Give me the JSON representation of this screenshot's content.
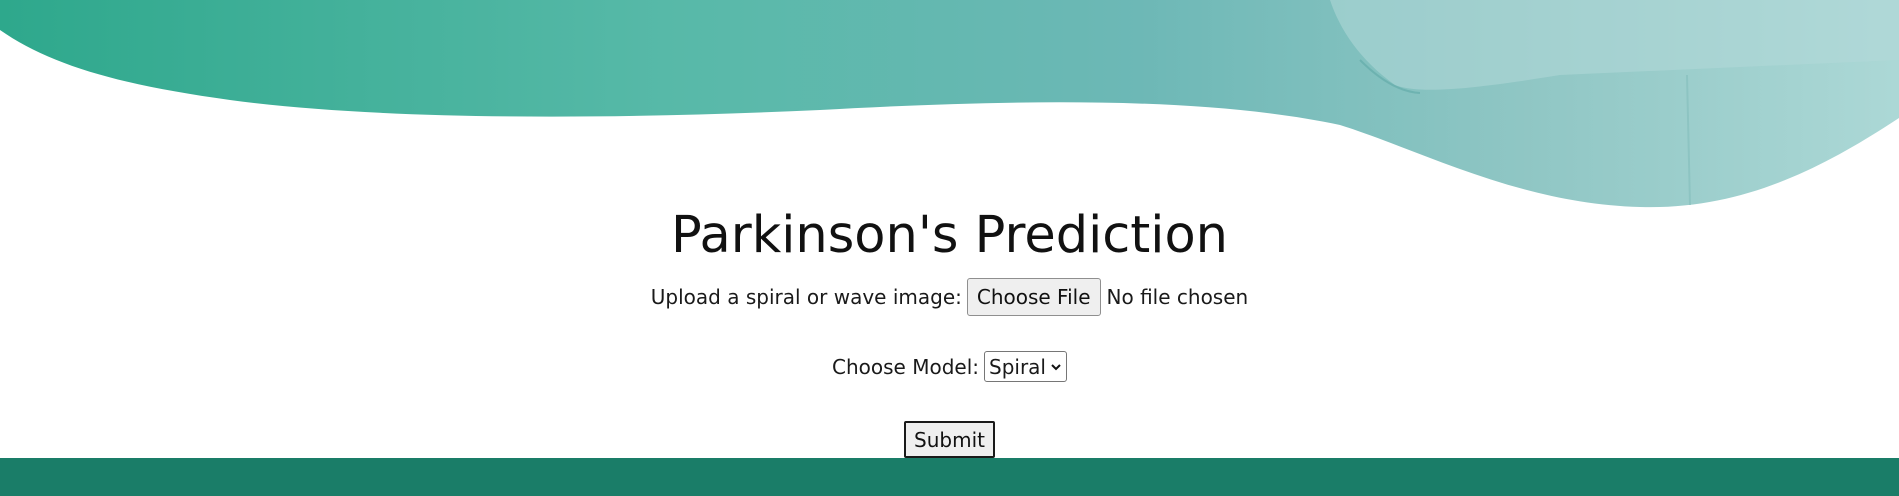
{
  "page": {
    "title": "Parkinson's Prediction"
  },
  "upload": {
    "label": "Upload a spiral or wave image:",
    "button_label": "Choose File",
    "status": "No file chosen"
  },
  "model": {
    "label": "Choose Model:",
    "selected": "Spiral"
  },
  "form": {
    "submit_label": "Submit"
  },
  "colors": {
    "accent": "#1a7d68",
    "wave_start": "#2ea88c",
    "wave_end": "#a9d6d4"
  },
  "icons": {
    "select_arrow": "chevron-down-icon"
  }
}
